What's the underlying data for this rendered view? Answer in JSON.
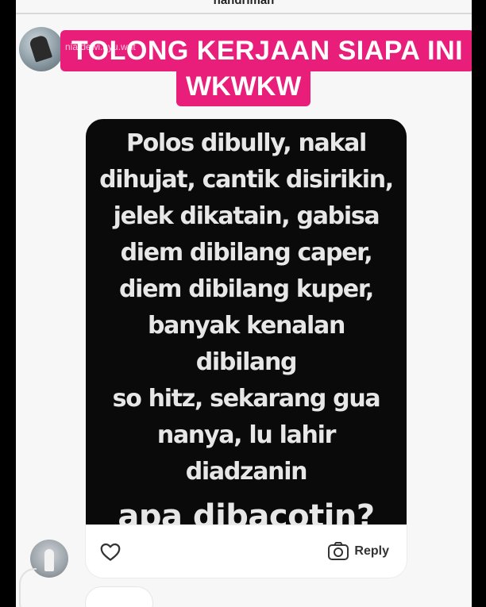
{
  "header": {
    "username": "nandriman"
  },
  "sender": {
    "handle": "nia.dewi.ayu.wnt"
  },
  "caption": {
    "line1": "TOLONG KERJAAN SIAPA INI",
    "line2": "WKWKW",
    "color": "#e91e7a"
  },
  "story": {
    "lines": [
      "Polos dibully, nakal",
      "dihujat, cantik disirikin,",
      "jelek dikatain, gabisa",
      "diem dibilang caper,",
      "diem dibilang kuper,",
      "banyak kenalan dibilang",
      "so hitz, sekarang gua",
      "nanya, lu lahir diadzanin",
      "apa dibacotin?"
    ],
    "background": "#0a0a0a"
  },
  "actions": {
    "like_icon": "heart-icon",
    "reply_icon": "camera-icon",
    "reply_label": "Reply"
  }
}
